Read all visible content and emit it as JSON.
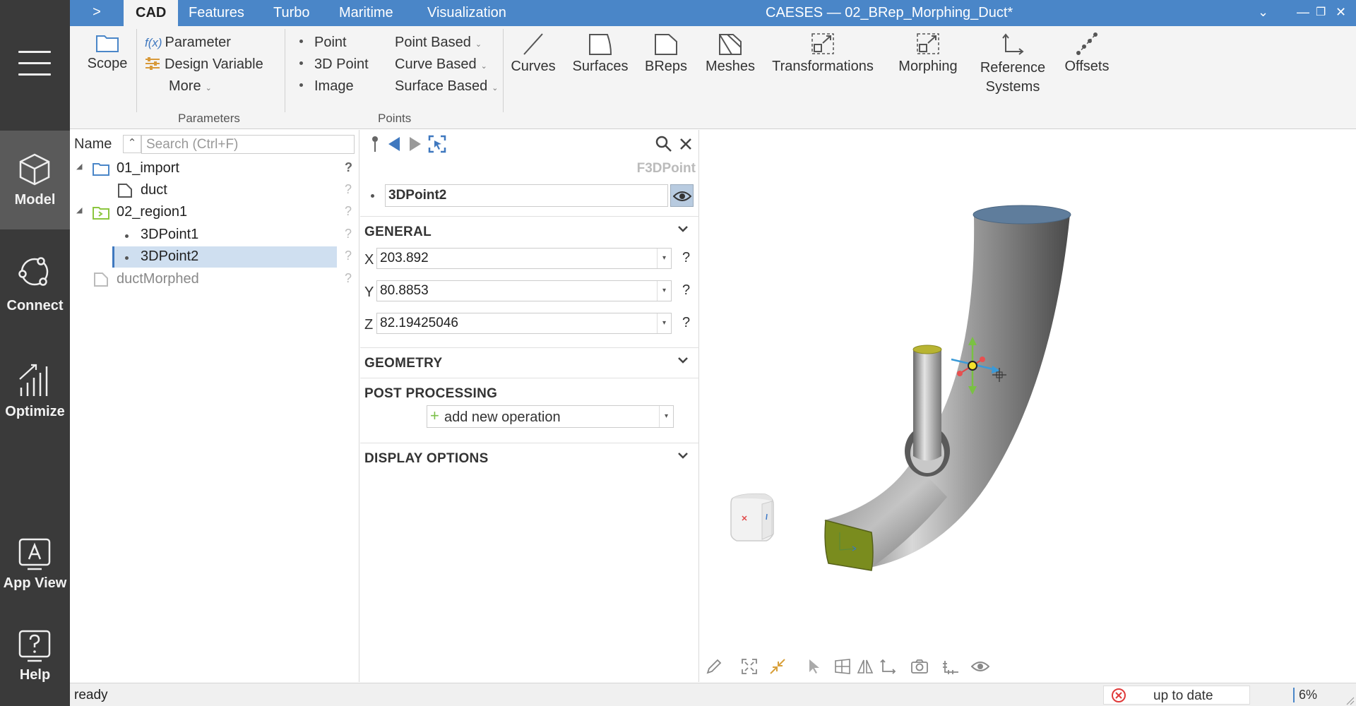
{
  "app": {
    "window_title": "CAESES — 02_BRep_Morphing_Duct*",
    "tabs": [
      "CAD",
      "Features",
      "Turbo",
      "Maritime",
      "Visualization"
    ],
    "active_tab": "CAD"
  },
  "sidebar": {
    "items": [
      {
        "label": "Model",
        "icon": "cube-icon"
      },
      {
        "label": "Connect",
        "icon": "connect-icon"
      },
      {
        "label": "Optimize",
        "icon": "optimize-icon"
      },
      {
        "label": "App View",
        "icon": "app-view-icon"
      },
      {
        "label": "Help",
        "icon": "help-icon"
      }
    ]
  },
  "ribbon": {
    "scope": "Scope",
    "parameter": "Parameter",
    "parameter_prefix": "f(x)",
    "design_variable": "Design Variable",
    "more": "More",
    "parameters_group": "Parameters",
    "point": "Point",
    "point_3d": "3D Point",
    "image": "Image",
    "point_based": "Point Based",
    "curve_based": "Curve Based",
    "surface_based": "Surface Based",
    "points_group": "Points",
    "curves": "Curves",
    "surfaces": "Surfaces",
    "breps": "BReps",
    "meshes": "Meshes",
    "transformations": "Transformations",
    "morphing": "Morphing",
    "reference_systems_1": "Reference",
    "reference_systems_2": "Systems",
    "offsets": "Offsets"
  },
  "tree": {
    "name_header": "Name",
    "search_placeholder": "Search (Ctrl+F)",
    "items": [
      {
        "label": "01_import"
      },
      {
        "label": "duct"
      },
      {
        "label": "02_region1"
      },
      {
        "label": "3DPoint1"
      },
      {
        "label": "3DPoint2"
      },
      {
        "label": "ductMorphed"
      }
    ],
    "help": "?"
  },
  "props": {
    "type_label": "F3DPoint",
    "object_name": "3DPoint2",
    "general": "GENERAL",
    "x_label": "X",
    "x_value": "203.892",
    "y_label": "Y",
    "y_value": "80.8853",
    "z_label": "Z",
    "z_value": "82.19425046",
    "geometry": "GEOMETRY",
    "post_processing": "POST PROCESSING",
    "add_operation": "add new operation",
    "display_options": "DISPLAY OPTIONS",
    "help": "?"
  },
  "status": {
    "text": "ready",
    "up_to_date": "up to date",
    "percent": "6%"
  },
  "colors": {
    "accent": "#4a86c8",
    "sidebar": "#3a3a3a",
    "duct_face": "#7a8c1e",
    "duct_top": "#5f7d9c"
  }
}
